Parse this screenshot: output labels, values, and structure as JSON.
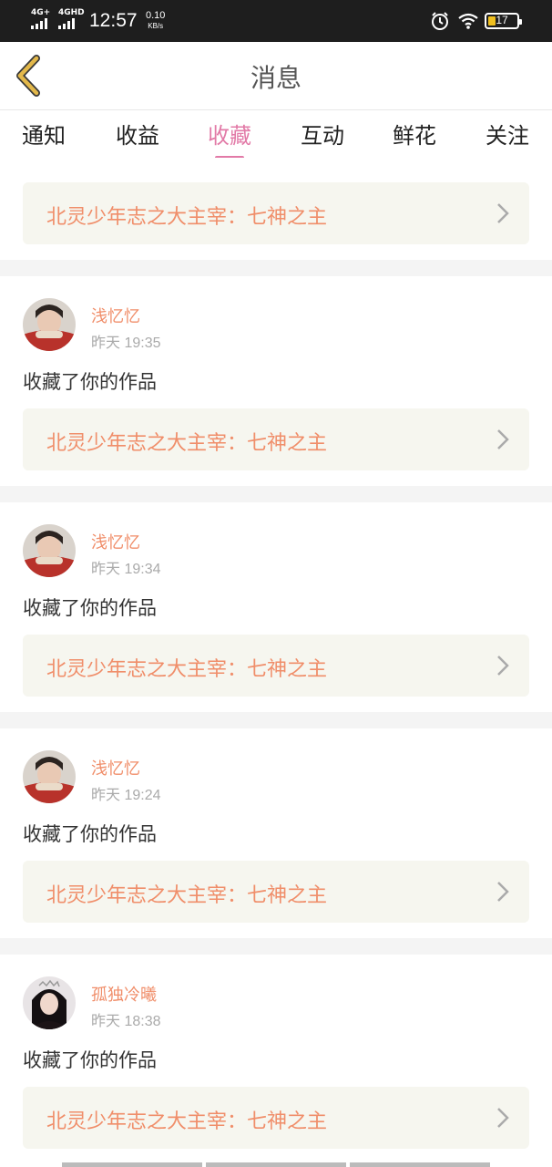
{
  "status_bar": {
    "signal1_label": "4G+",
    "signal2_label": "4GHD",
    "time": "12:57",
    "speed_value": "0.10",
    "speed_unit": "KB/s",
    "battery_level": "17",
    "alarm_icon": "alarm-icon",
    "wifi_icon": "wifi-icon"
  },
  "header": {
    "back_icon": "chevron-left-icon",
    "title": "消息"
  },
  "tabs": [
    {
      "label": "通知",
      "active": false
    },
    {
      "label": "收益",
      "active": false
    },
    {
      "label": "收藏",
      "active": true
    },
    {
      "label": "互动",
      "active": false
    },
    {
      "label": "鲜花",
      "active": false
    },
    {
      "label": "关注",
      "active": false
    }
  ],
  "top_partial": {
    "work_title": "北灵少年志之大主宰：七神之主"
  },
  "messages": [
    {
      "user": "浅忆忆",
      "time": "昨天 19:35",
      "action": "收藏了你的作品",
      "work_title": "北灵少年志之大主宰：七神之主"
    },
    {
      "user": "浅忆忆",
      "time": "昨天 19:34",
      "action": "收藏了你的作品",
      "work_title": "北灵少年志之大主宰：七神之主"
    },
    {
      "user": "浅忆忆",
      "time": "昨天 19:24",
      "action": "收藏了你的作品",
      "work_title": "北灵少年志之大主宰：七神之主"
    },
    {
      "user": "孤独冷曦",
      "time": "昨天 18:38",
      "action": "收藏了你的作品",
      "work_title": "北灵少年志之大主宰：七神之主"
    }
  ],
  "colors": {
    "accent_pink": "#e27aa7",
    "name_orange": "#f08e6a",
    "back_arrow": "#e3b84a"
  }
}
